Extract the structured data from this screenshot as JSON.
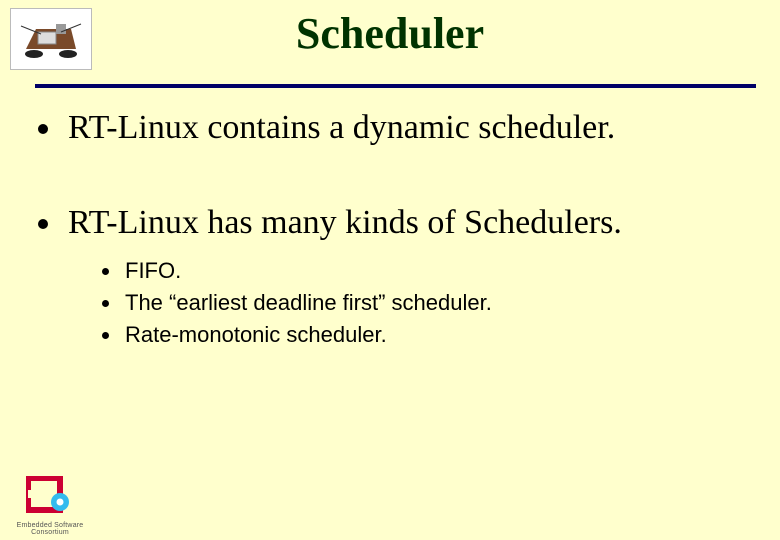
{
  "title": "Scheduler",
  "bullets": {
    "main": [
      "RT-Linux contains a dynamic scheduler.",
      "RT-Linux has many kinds of Schedulers."
    ],
    "sub": [
      "FIFO.",
      "The “earliest deadline first” scheduler.",
      "Rate-monotonic scheduler."
    ]
  },
  "logo_text": "Embedded Software Consortium"
}
